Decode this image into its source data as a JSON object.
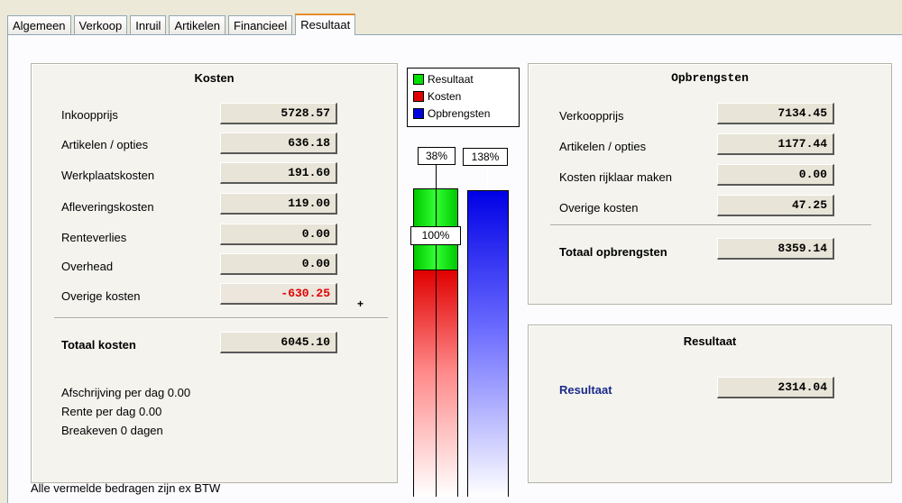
{
  "tabs": [
    {
      "label": "Algemeen"
    },
    {
      "label": "Verkoop"
    },
    {
      "label": "Inruil"
    },
    {
      "label": "Artikelen"
    },
    {
      "label": "Financieel"
    },
    {
      "label": "Resultaat"
    }
  ],
  "kosten": {
    "title": "Kosten",
    "rows": [
      {
        "label": "Inkoopprijs",
        "value": "5728.57"
      },
      {
        "label": "Artikelen / opties",
        "value": "636.18"
      },
      {
        "label": "Werkplaatskosten",
        "value": "191.60"
      },
      {
        "label": "Afleveringskosten",
        "value": "119.00"
      },
      {
        "label": "Renteverlies",
        "value": "0.00"
      },
      {
        "label": "Overhead",
        "value": "0.00"
      },
      {
        "label": "Overige kosten",
        "value": "-630.25"
      }
    ],
    "plus": "+",
    "total_label": "Totaal kosten",
    "total_value": "6045.10",
    "info": [
      "Afschrijving per dag 0.00",
      "Rente per dag 0.00",
      "Breakeven 0 dagen"
    ]
  },
  "legend": [
    {
      "label": "Resultaat",
      "color": "#00e000"
    },
    {
      "label": "Kosten",
      "color": "#e00000"
    },
    {
      "label": "Opbrengsten",
      "color": "#0000e0"
    }
  ],
  "chart_data": {
    "type": "bar",
    "labels": {
      "resultaat_pct": "38%",
      "opbrengsten_pct": "138%",
      "kosten_pct": "100%"
    },
    "values": {
      "kosten": 100,
      "resultaat": 38,
      "opbrengsten": 138
    }
  },
  "opbrengsten": {
    "title": "Opbrengsten",
    "rows": [
      {
        "label": "Verkoopprijs",
        "value": "7134.45"
      },
      {
        "label": "Artikelen / opties",
        "value": "1177.44"
      },
      {
        "label": "Kosten rijklaar maken",
        "value": "0.00"
      },
      {
        "label": "Overige kosten",
        "value": "47.25"
      }
    ],
    "total_label": "Totaal opbrengsten",
    "total_value": "8359.14"
  },
  "resultaat": {
    "title": "Resultaat",
    "label": "Resultaat",
    "value": "2314.04"
  },
  "status": "Alle vermelde bedragen zijn ex BTW"
}
